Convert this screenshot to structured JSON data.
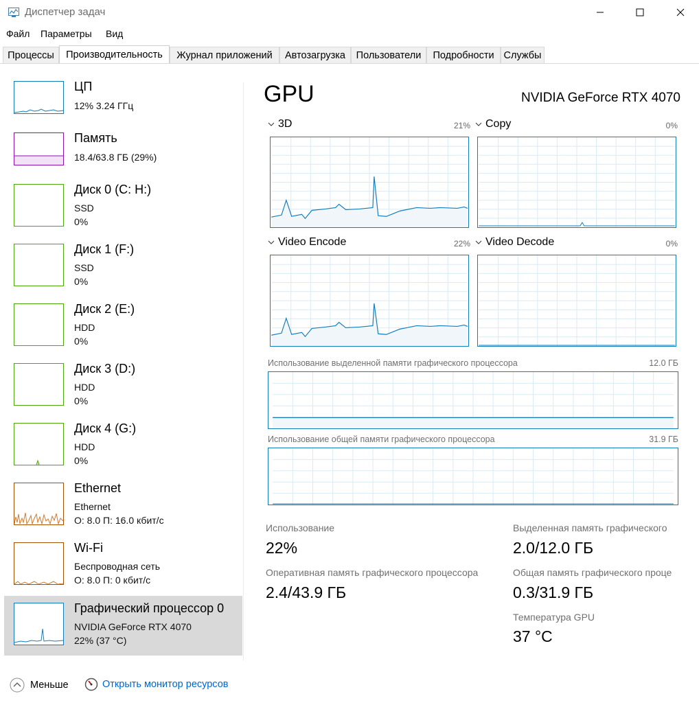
{
  "window": {
    "title": "Диспетчер задач",
    "controls": {
      "minimize": "—",
      "maximize": "☐",
      "close": "✕"
    }
  },
  "menu": [
    "Файл",
    "Параметры",
    "Вид"
  ],
  "tabs": [
    "Процессы",
    "Производительность",
    "Журнал приложений",
    "Автозагрузка",
    "Пользователи",
    "Подробности",
    "Службы"
  ],
  "active_tab": "Производительность",
  "sidebar": [
    {
      "title": "ЦП",
      "lines": [
        "12%  3.24 ГГц"
      ],
      "color": "#117dbb"
    },
    {
      "title": "Память",
      "lines": [
        "18.4/63.8 ГБ (29%)"
      ],
      "color": "#8b12ae"
    },
    {
      "title": "Диск 0 (C: H:)",
      "lines": [
        "SSD",
        "0%"
      ],
      "color": "#4da60c"
    },
    {
      "title": "Диск 1 (F:)",
      "lines": [
        "SSD",
        "0%"
      ],
      "color": "#4da60c"
    },
    {
      "title": "Диск 2 (E:)",
      "lines": [
        "HDD",
        "0%"
      ],
      "color": "#4da60c"
    },
    {
      "title": "Диск 3 (D:)",
      "lines": [
        "HDD",
        "0%"
      ],
      "color": "#4da60c"
    },
    {
      "title": "Диск 4 (G:)",
      "lines": [
        "HDD",
        "0%"
      ],
      "color": "#4da60c"
    },
    {
      "title": "Ethernet",
      "lines": [
        "Ethernet",
        "О: 8.0  П: 16.0 кбит/с"
      ],
      "color": "#a74f01"
    },
    {
      "title": "Wi-Fi",
      "lines": [
        "Беспроводная сеть",
        "О: 8.0  П: 0 кбит/с"
      ],
      "color": "#a74f01"
    },
    {
      "title": "Графический процессор 0",
      "lines": [
        "NVIDIA GeForce RTX 4070",
        "22%  (37 °C)"
      ],
      "color": "#117dbb"
    }
  ],
  "main": {
    "title": "GPU",
    "device_name": "NVIDIA GeForce RTX 4070",
    "engines": [
      {
        "name": "3D",
        "percent": "21%"
      },
      {
        "name": "Copy",
        "percent": "0%"
      },
      {
        "name": "Video Encode",
        "percent": "22%"
      },
      {
        "name": "Video Decode",
        "percent": "0%"
      }
    ],
    "dedicated_memory": {
      "label": "Использование выделенной памяти графического процессора",
      "max": "12.0 ГБ"
    },
    "shared_memory": {
      "label": "Использование общей памяти графического процессора",
      "max": "31.9 ГБ"
    },
    "stats": {
      "utilization_label": "Использование",
      "utilization_value": "22%",
      "dedicated_label": "Выделенная память графического",
      "dedicated_value": "2.0/12.0 ГБ",
      "gpu_memory_label": "Оперативная память графического процессора",
      "gpu_memory_value": "2.4/43.9 ГБ",
      "shared_label": "Общая память графического проце",
      "shared_value": "0.3/31.9 ГБ",
      "temp_label": "Температура GPU",
      "temp_value": "37 °C"
    }
  },
  "footer": {
    "less_label": "Меньше",
    "monitor_link": "Открыть монитор ресурсов"
  },
  "colors": {
    "gpu_line": "#117dbb",
    "grid": "#d9eaf4",
    "link": "#0066cc",
    "selected": "#d9d9d9"
  }
}
